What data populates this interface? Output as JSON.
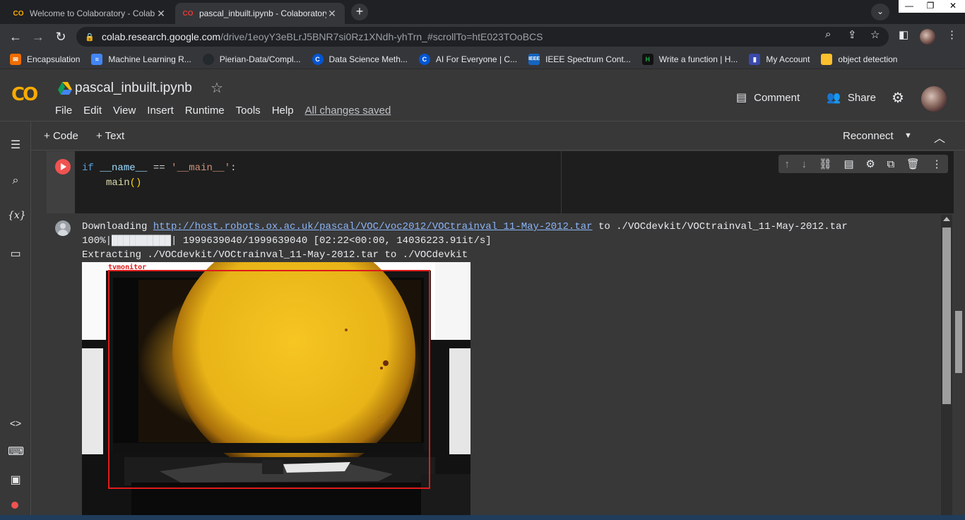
{
  "browser": {
    "tabs": [
      {
        "title": "Welcome to Colaboratory - Colab",
        "favicon": "CO",
        "active": false
      },
      {
        "title": "pascal_inbuilt.ipynb - Colaboratory",
        "favicon": "CO",
        "active": true
      }
    ],
    "tab_close": "✕",
    "new_tab": "+",
    "address": {
      "host": "colab.research.google.com",
      "path": "/drive/1eoyY3eBLrJ5BNR7si0Rz1XNdh-yhTrn_#scrollTo=htE023TOoBCS"
    },
    "window_controls": [
      "—",
      "❐",
      "✕"
    ]
  },
  "bookmarks": [
    {
      "label": "Encapsulation",
      "icon": "bookmark-icon",
      "color": "#ef6c00"
    },
    {
      "label": "Machine Learning R...",
      "icon": "doc-icon",
      "color": "#4285f4"
    },
    {
      "label": "Pierian-Data/Compl...",
      "icon": "github-icon",
      "color": "#24292e"
    },
    {
      "label": "Data Science Meth...",
      "icon": "coursera-icon",
      "color": "#0056d2"
    },
    {
      "label": "AI For Everyone | C...",
      "icon": "coursera-icon",
      "color": "#0056d2"
    },
    {
      "label": "IEEE Spectrum Cont...",
      "icon": "ieee-icon",
      "color": "#1565c0"
    },
    {
      "label": "Write a function | H...",
      "icon": "hackerrank-icon",
      "color": "#1ba94c"
    },
    {
      "label": "My Account",
      "icon": "bookmark-icon",
      "color": "#3949ab"
    },
    {
      "label": "object detection",
      "icon": "folder-icon",
      "color": "#fbc02d"
    }
  ],
  "colab": {
    "logo": "CO",
    "notebook_title": "pascal_inbuilt.ipynb",
    "menu": [
      "File",
      "Edit",
      "View",
      "Insert",
      "Runtime",
      "Tools",
      "Help"
    ],
    "save_status": "All changes saved",
    "comment_label": "Comment",
    "share_label": "Share",
    "toolbar": {
      "code": "Code",
      "text": "Text",
      "reconnect": "Reconnect"
    }
  },
  "cell": {
    "code": {
      "if_kw": "if",
      "name_var": "__name__",
      "eq": "==",
      "main_str": "'__main__'",
      "colon": ":",
      "call_fn": "main",
      "call_parens": "()"
    }
  },
  "output": {
    "downloading_prefix": "Downloading",
    "url": "http://host.robots.ox.ac.uk/pascal/VOC/voc2012/VOCtrainval_11-May-2012.tar",
    "downloading_suffix": "to ./VOCdevkit/VOCtrainval_11-May-2012.tar",
    "progress": "100%|██████████| 1999639040/1999639040 [02:22<00:00, 14036223.91it/s]",
    "extracting": "Extracting ./VOCdevkit/VOCtrainval_11-May-2012.tar to ./VOCdevkit",
    "detection_label": "tvmonitor"
  },
  "colors": {
    "accent": "#f9ab00",
    "run": "#ef5350",
    "link": "#8ab4f8",
    "bbox": "#e01b1b"
  }
}
